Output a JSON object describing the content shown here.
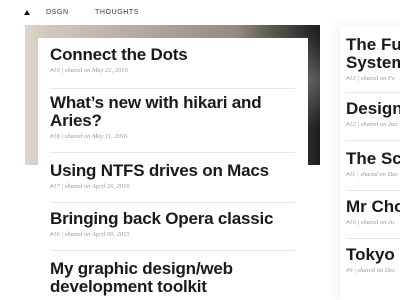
{
  "nav": {
    "logo_icon": "triangle-logo-icon",
    "links": [
      "DSGN",
      "THOUGHTS"
    ]
  },
  "articles": [
    {
      "title": "Connect the Dots",
      "number": "#19",
      "meta": "| shared on May 22, 2016"
    },
    {
      "title": "What’s new with hikari and Aries?",
      "number": "#18",
      "meta": "| shared on May 11, 2016"
    },
    {
      "title": "Using NTFS drives on Macs",
      "number": "#17",
      "meta": "| shared on April 26, 2016"
    },
    {
      "title": "Bringing back Opera classic",
      "number": "#16",
      "meta": "| shared on April 09, 2015"
    },
    {
      "title": "My graphic design/web development toolkit",
      "number": "",
      "meta": ""
    }
  ],
  "sidebar": [
    {
      "title": "The Fut System",
      "number": "#13",
      "meta": "| shared on Fe"
    },
    {
      "title": "Designi",
      "number": "#12",
      "meta": "| shared on Jan"
    },
    {
      "title": "The Scy",
      "number": "#11",
      "meta": "| shared on Dec"
    },
    {
      "title": "Mr Cho",
      "number": "#10",
      "meta": "| shared on Ju"
    },
    {
      "title": "Tokyo F",
      "number": "#9",
      "meta": "| shared on Dec"
    }
  ]
}
